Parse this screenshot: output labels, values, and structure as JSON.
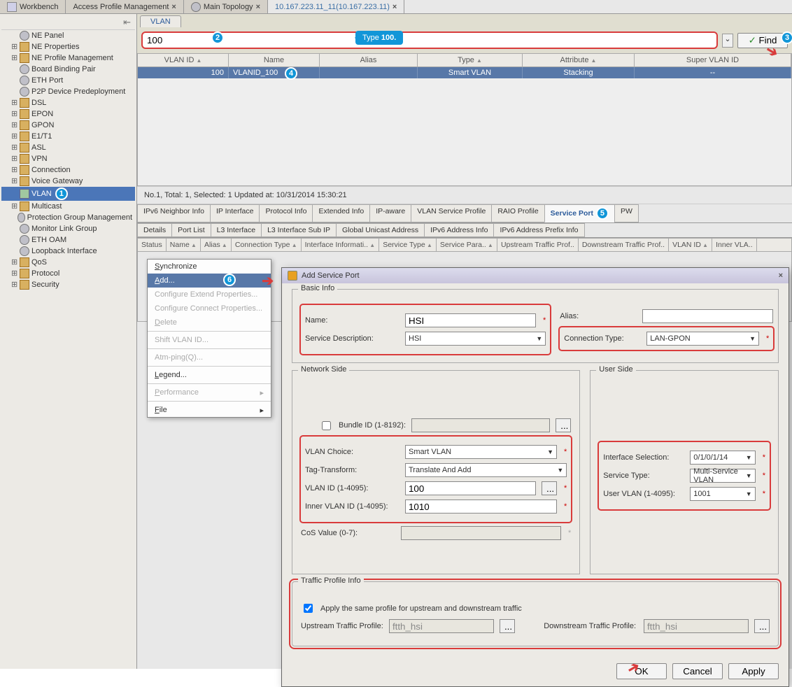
{
  "tabs": {
    "workbench": "Workbench",
    "access_profile": "Access Profile Management",
    "main_topology": "Main Topology",
    "ip_tab": "10.167.223.11_11(10.167.223.11)"
  },
  "sidebar": {
    "items": [
      {
        "label": "NE Panel",
        "exp": ""
      },
      {
        "label": "NE Properties",
        "exp": "+"
      },
      {
        "label": "NE Profile Management",
        "exp": "+"
      },
      {
        "label": "Board Binding Pair",
        "exp": ""
      },
      {
        "label": "ETH Port",
        "exp": ""
      },
      {
        "label": "P2P Device Predeployment",
        "exp": ""
      },
      {
        "label": "DSL",
        "exp": "+"
      },
      {
        "label": "EPON",
        "exp": "+"
      },
      {
        "label": "GPON",
        "exp": "+"
      },
      {
        "label": "E1/T1",
        "exp": "+"
      },
      {
        "label": "ASL",
        "exp": "+"
      },
      {
        "label": "VPN",
        "exp": "+"
      },
      {
        "label": "Connection",
        "exp": "+"
      },
      {
        "label": "Voice Gateway",
        "exp": "+"
      },
      {
        "label": "VLAN",
        "exp": "",
        "selected": true
      },
      {
        "label": "Multicast",
        "exp": "+"
      },
      {
        "label": "Protection Group Management",
        "exp": ""
      },
      {
        "label": "Monitor Link Group",
        "exp": ""
      },
      {
        "label": "ETH OAM",
        "exp": ""
      },
      {
        "label": "Loopback Interface",
        "exp": ""
      },
      {
        "label": "QoS",
        "exp": "+"
      },
      {
        "label": "Protocol",
        "exp": "+"
      },
      {
        "label": "Security",
        "exp": "+"
      }
    ]
  },
  "content": {
    "vlan_tab": "VLAN",
    "search_value": "100",
    "find_btn": "Find",
    "tooltip": "Type 100.",
    "columns": {
      "vlanid": "VLAN ID",
      "name": "Name",
      "alias": "Alias",
      "type": "Type",
      "attribute": "Attribute",
      "super": "Super VLAN ID"
    },
    "row": {
      "vlanid": "100",
      "name": "VLANID_100",
      "alias": "",
      "type": "Smart VLAN",
      "attribute": "Stacking",
      "super": "--"
    },
    "status": "No.1, Total: 1, Selected: 1   Updated at: 10/31/2014 15:30:21",
    "sub_tabs1": [
      "IPv6 Neighbor Info",
      "IP Interface",
      "Protocol Info",
      "Extended Info",
      "IP-aware",
      "VLAN Service Profile",
      "RAIO Profile",
      "Service Port",
      "PW"
    ],
    "sub_tabs2": [
      "Details",
      "Port List",
      "L3 Interface",
      "L3 Interface Sub IP",
      "Global Unicast Address",
      "IPv6 Address Info",
      "IPv6 Address Prefix Info"
    ],
    "sp_cols": [
      "Status",
      "Name",
      "Alias",
      "Connection Type",
      "Interface Informati..",
      "Service Type",
      "Service Para..",
      "Upstream Traffic Prof..",
      "Downstream Traffic Prof..",
      "VLAN ID",
      "Inner VLA.."
    ]
  },
  "context_menu": {
    "sync": "Synchronize",
    "add": "Add...",
    "cep": "Configure Extend Properties...",
    "ccp": "Configure Connect Properties...",
    "del": "Delete",
    "shift": "Shift VLAN ID...",
    "atm": "Atm-ping(Q)...",
    "legend": "Legend...",
    "perf": "Performance",
    "file": "File"
  },
  "dialog": {
    "title": "Add Service Port",
    "basic": {
      "legend": "Basic Info",
      "name_lbl": "Name:",
      "name_val": "HSI",
      "alias_lbl": "Alias:",
      "alias_val": "",
      "sdesc_lbl": "Service Description:",
      "sdesc_val": "HSI",
      "ctype_lbl": "Connection Type:",
      "ctype_val": "LAN-GPON"
    },
    "network": {
      "legend": "Network Side",
      "bundle_lbl": "Bundle ID (1-8192):",
      "vlan_choice_lbl": "VLAN Choice:",
      "vlan_choice_val": "Smart VLAN",
      "tag_lbl": "Tag-Transform:",
      "tag_val": "Translate And Add",
      "vlanid_lbl": "VLAN ID (1-4095):",
      "vlanid_val": "100",
      "inner_lbl": "Inner VLAN ID (1-4095):",
      "inner_val": "1010",
      "cos_lbl": "CoS Value (0-7):"
    },
    "user": {
      "legend": "User Side",
      "ifsel_lbl": "Interface Selection:",
      "ifsel_val": "0/1/0/1/14",
      "stype_lbl": "Service Type:",
      "stype_val": "Multi-Service VLAN",
      "uvlan_lbl": "User VLAN (1-4095):",
      "uvlan_val": "1001"
    },
    "traffic": {
      "legend": "Traffic Profile Info",
      "same_lbl": "Apply the same profile for upstream and downstream traffic",
      "up_lbl": "Upstream Traffic Profile:",
      "up_val": "ftth_hsi",
      "dn_lbl": "Downstream Traffic Profile:",
      "dn_val": "ftth_hsi"
    },
    "buttons": {
      "ok": "OK",
      "cancel": "Cancel",
      "apply": "Apply"
    }
  },
  "badges": {
    "b1": "1",
    "b2": "2",
    "b3": "3",
    "b4": "4",
    "b5": "5",
    "b6": "6"
  }
}
